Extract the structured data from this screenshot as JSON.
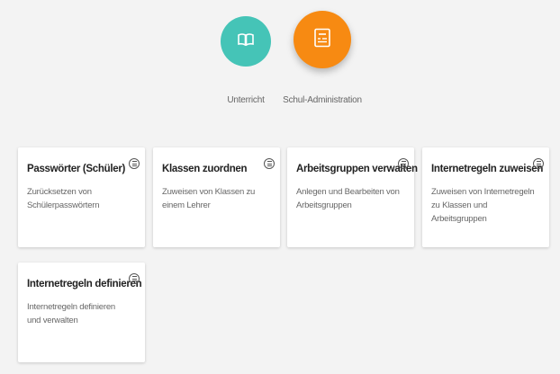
{
  "nav": {
    "items": [
      {
        "label": "Unterricht",
        "icon": "book-icon",
        "color": "#45c4b7"
      },
      {
        "label": "Schul-Administration",
        "icon": "admin-panel-icon",
        "color": "#f78a12"
      }
    ]
  },
  "cards": [
    {
      "title": "Passwörter (Schüler)",
      "description": "Zurücksetzen von Schülerpasswörtern"
    },
    {
      "title": "Klassen zuordnen",
      "description": "Zuweisen von Klassen zu einem Lehrer"
    },
    {
      "title": "Arbeitsgruppen verwalten",
      "description": "Anlegen und Bearbeiten von Arbeitsgruppen"
    },
    {
      "title": "Internetregeln zuweisen",
      "description": "Zuweisen von Internetregeln zu Klassen und Arbeitsgruppen"
    },
    {
      "title": "Internetregeln definieren",
      "description": "Internetregeln definieren und verwalten"
    }
  ]
}
